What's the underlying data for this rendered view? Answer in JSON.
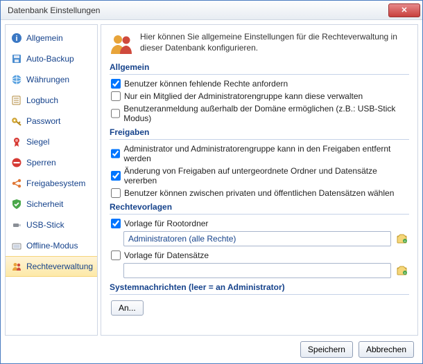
{
  "window": {
    "title": "Datenbank Einstellungen"
  },
  "sidebar": {
    "items": [
      {
        "label": "Allgemein",
        "icon": "info-icon"
      },
      {
        "label": "Auto-Backup",
        "icon": "disk-icon"
      },
      {
        "label": "Währungen",
        "icon": "globe-icon"
      },
      {
        "label": "Logbuch",
        "icon": "log-icon"
      },
      {
        "label": "Passwort",
        "icon": "key-icon"
      },
      {
        "label": "Siegel",
        "icon": "ribbon-icon"
      },
      {
        "label": "Sperren",
        "icon": "blocked-icon"
      },
      {
        "label": "Freigabesystem",
        "icon": "share-icon"
      },
      {
        "label": "Sicherheit",
        "icon": "shield-icon"
      },
      {
        "label": "USB-Stick",
        "icon": "usb-icon"
      },
      {
        "label": "Offline-Modus",
        "icon": "offline-icon"
      },
      {
        "label": "Rechteverwaltung",
        "icon": "users-icon",
        "selected": true
      }
    ]
  },
  "intro": {
    "text": "Hier können Sie allgemeine Einstellungen für die Rechteverwaltung in dieser Datenbank konfigurieren."
  },
  "sections": {
    "allgemein": {
      "title": "Allgemein",
      "opts": [
        {
          "label": "Benutzer können fehlende Rechte anfordern",
          "checked": true
        },
        {
          "label": "Nur ein Mitglied der Administratorengruppe kann diese verwalten",
          "checked": false
        },
        {
          "label": "Benutzeranmeldung außerhalb der Domäne ermöglichen (z.B.: USB-Stick Modus)",
          "checked": false
        }
      ]
    },
    "freigaben": {
      "title": "Freigaben",
      "opts": [
        {
          "label": "Administrator und Administratorengruppe kann in den Freigaben entfernt werden",
          "checked": true
        },
        {
          "label": "Änderung von Freigaben auf untergeordnete Ordner und Datensätze vererben",
          "checked": true
        },
        {
          "label": "Benutzer können zwischen privaten und öffentlichen Datensätzen wählen",
          "checked": false
        }
      ]
    },
    "rechtevorlagen": {
      "title": "Rechtevorlagen",
      "root_chk": {
        "label": "Vorlage für Rootordner",
        "checked": true
      },
      "root_value": "Administratoren (alle Rechte)",
      "ds_chk": {
        "label": "Vorlage für Datensätze",
        "checked": false
      },
      "ds_value": ""
    },
    "sysmsg": {
      "title": "Systemnachrichten (leer = an Administrator)",
      "an_label": "An..."
    }
  },
  "footer": {
    "save": "Speichern",
    "cancel": "Abbrechen"
  }
}
